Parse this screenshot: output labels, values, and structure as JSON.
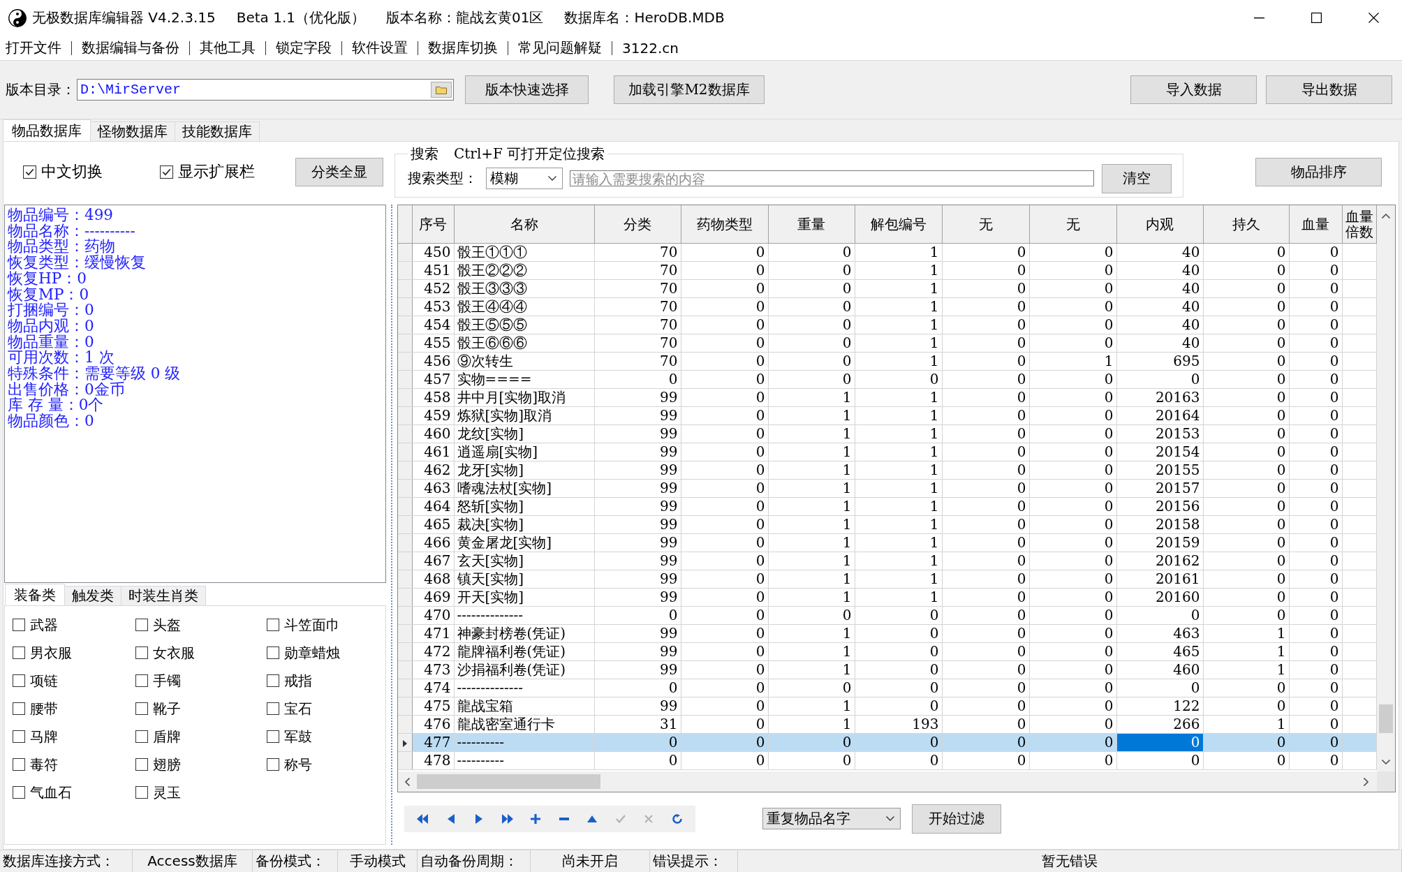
{
  "window": {
    "title_parts": [
      "无极数据库编辑器 V4.2.3.15",
      "Beta 1.1（优化版）",
      "版本名称：龍战玄黄01区",
      "数据库名：HeroDB.MDB"
    ]
  },
  "menu": [
    "打开文件",
    "数据编辑与备份",
    "其他工具",
    "锁定字段",
    "软件设置",
    "数据库切换",
    "常见问题解疑",
    "3122.cn"
  ],
  "toolbar": {
    "directory_label": "版本目录：",
    "directory": "D:\\MirServer",
    "buttons": [
      "版本快速选择",
      "加载引擎M2数据库"
    ],
    "data_buttons": [
      "导入数据",
      "导出数据"
    ]
  },
  "tabs": [
    {
      "label": "物品数据库",
      "selected": true
    },
    {
      "label": "怪物数据库",
      "selected": false
    },
    {
      "label": "技能数据库",
      "selected": false
    }
  ],
  "options": {
    "checkboxes": [
      {
        "label": "中文切换",
        "checked": true
      },
      {
        "label": "显示扩展栏",
        "checked": true
      }
    ],
    "button": "分类全显"
  },
  "search": {
    "title": "搜索",
    "hint": "Ctrl+F 可打开定位搜索",
    "type_label": "搜索类型：",
    "type_value": "模糊",
    "placeholder": "请输入需要搜索的内容",
    "clear_button": "清空"
  },
  "sort_button": "物品排序",
  "item_info": [
    "物品编号：499",
    "物品名称：----------",
    "物品类型：药物",
    "恢复类型：缓慢恢复",
    "恢复HP：0",
    "恢复MP：0",
    "打捆编号：0",
    "物品内观：0",
    "物品重量：0",
    "可用次数：1 次",
    "特殊条件：需要等级 0 级",
    "出售价格：0金币",
    "库 存 量：0个",
    "物品颜色：0"
  ],
  "category_tabs": [
    {
      "label": "装备类",
      "selected": true
    },
    {
      "label": "触发类",
      "selected": false
    },
    {
      "label": "时装生肖类",
      "selected": false
    }
  ],
  "categories": [
    {
      "label": "武器",
      "checked": false
    },
    {
      "label": "头盔",
      "checked": false
    },
    {
      "label": "斗笠面巾",
      "checked": false
    },
    {
      "label": "男衣服",
      "checked": false
    },
    {
      "label": "女衣服",
      "checked": false
    },
    {
      "label": "勋章蜡烛",
      "checked": false
    },
    {
      "label": "项链",
      "checked": false
    },
    {
      "label": "手镯",
      "checked": false
    },
    {
      "label": "戒指",
      "checked": false
    },
    {
      "label": "腰带",
      "checked": false
    },
    {
      "label": "靴子",
      "checked": false
    },
    {
      "label": "宝石",
      "checked": false
    },
    {
      "label": "马牌",
      "checked": false
    },
    {
      "label": "盾牌",
      "checked": false
    },
    {
      "label": "军鼓",
      "checked": false
    },
    {
      "label": "毒符",
      "checked": false
    },
    {
      "label": "翅膀",
      "checked": false
    },
    {
      "label": "称号",
      "checked": false
    },
    {
      "label": "气血石",
      "checked": false
    },
    {
      "label": "灵玉",
      "checked": false
    }
  ],
  "table": {
    "columns": [
      "序号",
      "名称",
      "分类",
      "药物类型",
      "重量",
      "解包编号",
      "无",
      "无",
      "内观",
      "持久",
      "血量",
      "血量倍数"
    ],
    "rows": [
      {
        "selected": false,
        "cells": [
          {
            "text": "450",
            "focused": false
          },
          {
            "text": "骰王①①①",
            "focused": false
          },
          {
            "text": "70",
            "focused": false
          },
          {
            "text": "0",
            "focused": false
          },
          {
            "text": "0",
            "focused": false
          },
          {
            "text": "1",
            "focused": false
          },
          {
            "text": "0",
            "focused": false
          },
          {
            "text": "0",
            "focused": false
          },
          {
            "text": "40",
            "focused": false
          },
          {
            "text": "0",
            "focused": false
          },
          {
            "text": "0",
            "focused": false
          }
        ]
      },
      {
        "selected": false,
        "cells": [
          {
            "text": "451",
            "focused": false
          },
          {
            "text": "骰王②②②",
            "focused": false
          },
          {
            "text": "70",
            "focused": false
          },
          {
            "text": "0",
            "focused": false
          },
          {
            "text": "0",
            "focused": false
          },
          {
            "text": "1",
            "focused": false
          },
          {
            "text": "0",
            "focused": false
          },
          {
            "text": "0",
            "focused": false
          },
          {
            "text": "40",
            "focused": false
          },
          {
            "text": "0",
            "focused": false
          },
          {
            "text": "0",
            "focused": false
          }
        ]
      },
      {
        "selected": false,
        "cells": [
          {
            "text": "452",
            "focused": false
          },
          {
            "text": "骰王③③③",
            "focused": false
          },
          {
            "text": "70",
            "focused": false
          },
          {
            "text": "0",
            "focused": false
          },
          {
            "text": "0",
            "focused": false
          },
          {
            "text": "1",
            "focused": false
          },
          {
            "text": "0",
            "focused": false
          },
          {
            "text": "0",
            "focused": false
          },
          {
            "text": "40",
            "focused": false
          },
          {
            "text": "0",
            "focused": false
          },
          {
            "text": "0",
            "focused": false
          }
        ]
      },
      {
        "selected": false,
        "cells": [
          {
            "text": "453",
            "focused": false
          },
          {
            "text": "骰王④④④",
            "focused": false
          },
          {
            "text": "70",
            "focused": false
          },
          {
            "text": "0",
            "focused": false
          },
          {
            "text": "0",
            "focused": false
          },
          {
            "text": "1",
            "focused": false
          },
          {
            "text": "0",
            "focused": false
          },
          {
            "text": "0",
            "focused": false
          },
          {
            "text": "40",
            "focused": false
          },
          {
            "text": "0",
            "focused": false
          },
          {
            "text": "0",
            "focused": false
          }
        ]
      },
      {
        "selected": false,
        "cells": [
          {
            "text": "454",
            "focused": false
          },
          {
            "text": "骰王⑤⑤⑤",
            "focused": false
          },
          {
            "text": "70",
            "focused": false
          },
          {
            "text": "0",
            "focused": false
          },
          {
            "text": "0",
            "focused": false
          },
          {
            "text": "1",
            "focused": false
          },
          {
            "text": "0",
            "focused": false
          },
          {
            "text": "0",
            "focused": false
          },
          {
            "text": "40",
            "focused": false
          },
          {
            "text": "0",
            "focused": false
          },
          {
            "text": "0",
            "focused": false
          }
        ]
      },
      {
        "selected": false,
        "cells": [
          {
            "text": "455",
            "focused": false
          },
          {
            "text": "骰王⑥⑥⑥",
            "focused": false
          },
          {
            "text": "70",
            "focused": false
          },
          {
            "text": "0",
            "focused": false
          },
          {
            "text": "0",
            "focused": false
          },
          {
            "text": "1",
            "focused": false
          },
          {
            "text": "0",
            "focused": false
          },
          {
            "text": "0",
            "focused": false
          },
          {
            "text": "40",
            "focused": false
          },
          {
            "text": "0",
            "focused": false
          },
          {
            "text": "0",
            "focused": false
          }
        ]
      },
      {
        "selected": false,
        "cells": [
          {
            "text": "456",
            "focused": false
          },
          {
            "text": "⑨次转生",
            "focused": false
          },
          {
            "text": "70",
            "focused": false
          },
          {
            "text": "0",
            "focused": false
          },
          {
            "text": "0",
            "focused": false
          },
          {
            "text": "1",
            "focused": false
          },
          {
            "text": "0",
            "focused": false
          },
          {
            "text": "1",
            "focused": false
          },
          {
            "text": "695",
            "focused": false
          },
          {
            "text": "0",
            "focused": false
          },
          {
            "text": "0",
            "focused": false
          }
        ]
      },
      {
        "selected": false,
        "cells": [
          {
            "text": "457",
            "focused": false
          },
          {
            "text": "实物====",
            "focused": false
          },
          {
            "text": "0",
            "focused": false
          },
          {
            "text": "0",
            "focused": false
          },
          {
            "text": "0",
            "focused": false
          },
          {
            "text": "0",
            "focused": false
          },
          {
            "text": "0",
            "focused": false
          },
          {
            "text": "0",
            "focused": false
          },
          {
            "text": "0",
            "focused": false
          },
          {
            "text": "0",
            "focused": false
          },
          {
            "text": "0",
            "focused": false
          }
        ]
      },
      {
        "selected": false,
        "cells": [
          {
            "text": "458",
            "focused": false
          },
          {
            "text": "井中月[实物]取消",
            "focused": false
          },
          {
            "text": "99",
            "focused": false
          },
          {
            "text": "0",
            "focused": false
          },
          {
            "text": "1",
            "focused": false
          },
          {
            "text": "1",
            "focused": false
          },
          {
            "text": "0",
            "focused": false
          },
          {
            "text": "0",
            "focused": false
          },
          {
            "text": "20163",
            "focused": false
          },
          {
            "text": "0",
            "focused": false
          },
          {
            "text": "0",
            "focused": false
          }
        ]
      },
      {
        "selected": false,
        "cells": [
          {
            "text": "459",
            "focused": false
          },
          {
            "text": "炼狱[实物]取消",
            "focused": false
          },
          {
            "text": "99",
            "focused": false
          },
          {
            "text": "0",
            "focused": false
          },
          {
            "text": "1",
            "focused": false
          },
          {
            "text": "1",
            "focused": false
          },
          {
            "text": "0",
            "focused": false
          },
          {
            "text": "0",
            "focused": false
          },
          {
            "text": "20164",
            "focused": false
          },
          {
            "text": "0",
            "focused": false
          },
          {
            "text": "0",
            "focused": false
          }
        ]
      },
      {
        "selected": false,
        "cells": [
          {
            "text": "460",
            "focused": false
          },
          {
            "text": "龙纹[实物]",
            "focused": false
          },
          {
            "text": "99",
            "focused": false
          },
          {
            "text": "0",
            "focused": false
          },
          {
            "text": "1",
            "focused": false
          },
          {
            "text": "1",
            "focused": false
          },
          {
            "text": "0",
            "focused": false
          },
          {
            "text": "0",
            "focused": false
          },
          {
            "text": "20153",
            "focused": false
          },
          {
            "text": "0",
            "focused": false
          },
          {
            "text": "0",
            "focused": false
          }
        ]
      },
      {
        "selected": false,
        "cells": [
          {
            "text": "461",
            "focused": false
          },
          {
            "text": "逍遥扇[实物]",
            "focused": false
          },
          {
            "text": "99",
            "focused": false
          },
          {
            "text": "0",
            "focused": false
          },
          {
            "text": "1",
            "focused": false
          },
          {
            "text": "1",
            "focused": false
          },
          {
            "text": "0",
            "focused": false
          },
          {
            "text": "0",
            "focused": false
          },
          {
            "text": "20154",
            "focused": false
          },
          {
            "text": "0",
            "focused": false
          },
          {
            "text": "0",
            "focused": false
          }
        ]
      },
      {
        "selected": false,
        "cells": [
          {
            "text": "462",
            "focused": false
          },
          {
            "text": "龙牙[实物]",
            "focused": false
          },
          {
            "text": "99",
            "focused": false
          },
          {
            "text": "0",
            "focused": false
          },
          {
            "text": "1",
            "focused": false
          },
          {
            "text": "1",
            "focused": false
          },
          {
            "text": "0",
            "focused": false
          },
          {
            "text": "0",
            "focused": false
          },
          {
            "text": "20155",
            "focused": false
          },
          {
            "text": "0",
            "focused": false
          },
          {
            "text": "0",
            "focused": false
          }
        ]
      },
      {
        "selected": false,
        "cells": [
          {
            "text": "463",
            "focused": false
          },
          {
            "text": "嗜魂法杖[实物]",
            "focused": false
          },
          {
            "text": "99",
            "focused": false
          },
          {
            "text": "0",
            "focused": false
          },
          {
            "text": "1",
            "focused": false
          },
          {
            "text": "1",
            "focused": false
          },
          {
            "text": "0",
            "focused": false
          },
          {
            "text": "0",
            "focused": false
          },
          {
            "text": "20157",
            "focused": false
          },
          {
            "text": "0",
            "focused": false
          },
          {
            "text": "0",
            "focused": false
          }
        ]
      },
      {
        "selected": false,
        "cells": [
          {
            "text": "464",
            "focused": false
          },
          {
            "text": "怒斩[实物]",
            "focused": false
          },
          {
            "text": "99",
            "focused": false
          },
          {
            "text": "0",
            "focused": false
          },
          {
            "text": "1",
            "focused": false
          },
          {
            "text": "1",
            "focused": false
          },
          {
            "text": "0",
            "focused": false
          },
          {
            "text": "0",
            "focused": false
          },
          {
            "text": "20156",
            "focused": false
          },
          {
            "text": "0",
            "focused": false
          },
          {
            "text": "0",
            "focused": false
          }
        ]
      },
      {
        "selected": false,
        "cells": [
          {
            "text": "465",
            "focused": false
          },
          {
            "text": "裁决[实物]",
            "focused": false
          },
          {
            "text": "99",
            "focused": false
          },
          {
            "text": "0",
            "focused": false
          },
          {
            "text": "1",
            "focused": false
          },
          {
            "text": "1",
            "focused": false
          },
          {
            "text": "0",
            "focused": false
          },
          {
            "text": "0",
            "focused": false
          },
          {
            "text": "20158",
            "focused": false
          },
          {
            "text": "0",
            "focused": false
          },
          {
            "text": "0",
            "focused": false
          }
        ]
      },
      {
        "selected": false,
        "cells": [
          {
            "text": "466",
            "focused": false
          },
          {
            "text": "黄金屠龙[实物]",
            "focused": false
          },
          {
            "text": "99",
            "focused": false
          },
          {
            "text": "0",
            "focused": false
          },
          {
            "text": "1",
            "focused": false
          },
          {
            "text": "1",
            "focused": false
          },
          {
            "text": "0",
            "focused": false
          },
          {
            "text": "0",
            "focused": false
          },
          {
            "text": "20159",
            "focused": false
          },
          {
            "text": "0",
            "focused": false
          },
          {
            "text": "0",
            "focused": false
          }
        ]
      },
      {
        "selected": false,
        "cells": [
          {
            "text": "467",
            "focused": false
          },
          {
            "text": "玄天[实物]",
            "focused": false
          },
          {
            "text": "99",
            "focused": false
          },
          {
            "text": "0",
            "focused": false
          },
          {
            "text": "1",
            "focused": false
          },
          {
            "text": "1",
            "focused": false
          },
          {
            "text": "0",
            "focused": false
          },
          {
            "text": "0",
            "focused": false
          },
          {
            "text": "20162",
            "focused": false
          },
          {
            "text": "0",
            "focused": false
          },
          {
            "text": "0",
            "focused": false
          }
        ]
      },
      {
        "selected": false,
        "cells": [
          {
            "text": "468",
            "focused": false
          },
          {
            "text": "镇天[实物]",
            "focused": false
          },
          {
            "text": "99",
            "focused": false
          },
          {
            "text": "0",
            "focused": false
          },
          {
            "text": "1",
            "focused": false
          },
          {
            "text": "1",
            "focused": false
          },
          {
            "text": "0",
            "focused": false
          },
          {
            "text": "0",
            "focused": false
          },
          {
            "text": "20161",
            "focused": false
          },
          {
            "text": "0",
            "focused": false
          },
          {
            "text": "0",
            "focused": false
          }
        ]
      },
      {
        "selected": false,
        "cells": [
          {
            "text": "469",
            "focused": false
          },
          {
            "text": "开天[实物]",
            "focused": false
          },
          {
            "text": "99",
            "focused": false
          },
          {
            "text": "0",
            "focused": false
          },
          {
            "text": "1",
            "focused": false
          },
          {
            "text": "1",
            "focused": false
          },
          {
            "text": "0",
            "focused": false
          },
          {
            "text": "0",
            "focused": false
          },
          {
            "text": "20160",
            "focused": false
          },
          {
            "text": "0",
            "focused": false
          },
          {
            "text": "0",
            "focused": false
          }
        ]
      },
      {
        "selected": false,
        "cells": [
          {
            "text": "470",
            "focused": false
          },
          {
            "text": "--------------",
            "focused": false
          },
          {
            "text": "0",
            "focused": false
          },
          {
            "text": "0",
            "focused": false
          },
          {
            "text": "0",
            "focused": false
          },
          {
            "text": "0",
            "focused": false
          },
          {
            "text": "0",
            "focused": false
          },
          {
            "text": "0",
            "focused": false
          },
          {
            "text": "0",
            "focused": false
          },
          {
            "text": "0",
            "focused": false
          },
          {
            "text": "0",
            "focused": false
          }
        ]
      },
      {
        "selected": false,
        "cells": [
          {
            "text": "471",
            "focused": false
          },
          {
            "text": "神豪封榜卷(凭证)",
            "focused": false
          },
          {
            "text": "99",
            "focused": false
          },
          {
            "text": "0",
            "focused": false
          },
          {
            "text": "1",
            "focused": false
          },
          {
            "text": "0",
            "focused": false
          },
          {
            "text": "0",
            "focused": false
          },
          {
            "text": "0",
            "focused": false
          },
          {
            "text": "463",
            "focused": false
          },
          {
            "text": "1",
            "focused": false
          },
          {
            "text": "0",
            "focused": false
          }
        ]
      },
      {
        "selected": false,
        "cells": [
          {
            "text": "472",
            "focused": false
          },
          {
            "text": "龍牌福利卷(凭证)",
            "focused": false
          },
          {
            "text": "99",
            "focused": false
          },
          {
            "text": "0",
            "focused": false
          },
          {
            "text": "1",
            "focused": false
          },
          {
            "text": "0",
            "focused": false
          },
          {
            "text": "0",
            "focused": false
          },
          {
            "text": "0",
            "focused": false
          },
          {
            "text": "465",
            "focused": false
          },
          {
            "text": "1",
            "focused": false
          },
          {
            "text": "0",
            "focused": false
          }
        ]
      },
      {
        "selected": false,
        "cells": [
          {
            "text": "473",
            "focused": false
          },
          {
            "text": "沙捐福利卷(凭证)",
            "focused": false
          },
          {
            "text": "99",
            "focused": false
          },
          {
            "text": "0",
            "focused": false
          },
          {
            "text": "1",
            "focused": false
          },
          {
            "text": "0",
            "focused": false
          },
          {
            "text": "0",
            "focused": false
          },
          {
            "text": "0",
            "focused": false
          },
          {
            "text": "460",
            "focused": false
          },
          {
            "text": "1",
            "focused": false
          },
          {
            "text": "0",
            "focused": false
          }
        ]
      },
      {
        "selected": false,
        "cells": [
          {
            "text": "474",
            "focused": false
          },
          {
            "text": "--------------",
            "focused": false
          },
          {
            "text": "0",
            "focused": false
          },
          {
            "text": "0",
            "focused": false
          },
          {
            "text": "0",
            "focused": false
          },
          {
            "text": "0",
            "focused": false
          },
          {
            "text": "0",
            "focused": false
          },
          {
            "text": "0",
            "focused": false
          },
          {
            "text": "0",
            "focused": false
          },
          {
            "text": "0",
            "focused": false
          },
          {
            "text": "0",
            "focused": false
          }
        ]
      },
      {
        "selected": false,
        "cells": [
          {
            "text": "475",
            "focused": false
          },
          {
            "text": "龍战宝箱",
            "focused": false
          },
          {
            "text": "99",
            "focused": false
          },
          {
            "text": "0",
            "focused": false
          },
          {
            "text": "1",
            "focused": false
          },
          {
            "text": "0",
            "focused": false
          },
          {
            "text": "0",
            "focused": false
          },
          {
            "text": "0",
            "focused": false
          },
          {
            "text": "122",
            "focused": false
          },
          {
            "text": "0",
            "focused": false
          },
          {
            "text": "0",
            "focused": false
          }
        ]
      },
      {
        "selected": false,
        "cells": [
          {
            "text": "476",
            "focused": false
          },
          {
            "text": "龍战密室通行卡",
            "focused": false
          },
          {
            "text": "31",
            "focused": false
          },
          {
            "text": "0",
            "focused": false
          },
          {
            "text": "1",
            "focused": false
          },
          {
            "text": "193",
            "focused": false
          },
          {
            "text": "0",
            "focused": false
          },
          {
            "text": "0",
            "focused": false
          },
          {
            "text": "266",
            "focused": false
          },
          {
            "text": "1",
            "focused": false
          },
          {
            "text": "0",
            "focused": false
          }
        ]
      },
      {
        "selected": true,
        "cells": [
          {
            "text": "477",
            "focused": false
          },
          {
            "text": "----------",
            "focused": false
          },
          {
            "text": "0",
            "focused": false
          },
          {
            "text": "0",
            "focused": false
          },
          {
            "text": "0",
            "focused": false
          },
          {
            "text": "0",
            "focused": false
          },
          {
            "text": "0",
            "focused": false
          },
          {
            "text": "0",
            "focused": false
          },
          {
            "text": "0",
            "focused": true
          },
          {
            "text": "0",
            "focused": false
          },
          {
            "text": "0",
            "focused": false
          }
        ]
      },
      {
        "selected": false,
        "cells": [
          {
            "text": "478",
            "focused": false
          },
          {
            "text": "----------",
            "focused": false
          },
          {
            "text": "0",
            "focused": false
          },
          {
            "text": "0",
            "focused": false
          },
          {
            "text": "0",
            "focused": false
          },
          {
            "text": "0",
            "focused": false
          },
          {
            "text": "0",
            "focused": false
          },
          {
            "text": "0",
            "focused": false
          },
          {
            "text": "0",
            "focused": false
          },
          {
            "text": "0",
            "focused": false
          },
          {
            "text": "0",
            "focused": false
          }
        ]
      }
    ]
  },
  "navigator": [
    {
      "kind": "first",
      "disabled": false
    },
    {
      "kind": "prior",
      "disabled": false
    },
    {
      "kind": "next",
      "disabled": false
    },
    {
      "kind": "last",
      "disabled": false
    },
    {
      "kind": "insert",
      "disabled": false
    },
    {
      "kind": "delete",
      "disabled": false
    },
    {
      "kind": "edit",
      "disabled": false
    },
    {
      "kind": "post",
      "disabled": true
    },
    {
      "kind": "cancel",
      "disabled": true
    },
    {
      "kind": "refresh",
      "disabled": false
    }
  ],
  "filter": {
    "value": "重复物品名字",
    "button": "开始过滤"
  },
  "status_bar": [
    {
      "label": "数据库连接方式：",
      "value": "Access数据库"
    },
    {
      "label": "备份模式：",
      "value": "手动模式"
    },
    {
      "label": "自动备份周期：",
      "value": "尚未开启"
    },
    {
      "label": "错误提示：",
      "value": "暂无错误"
    }
  ]
}
